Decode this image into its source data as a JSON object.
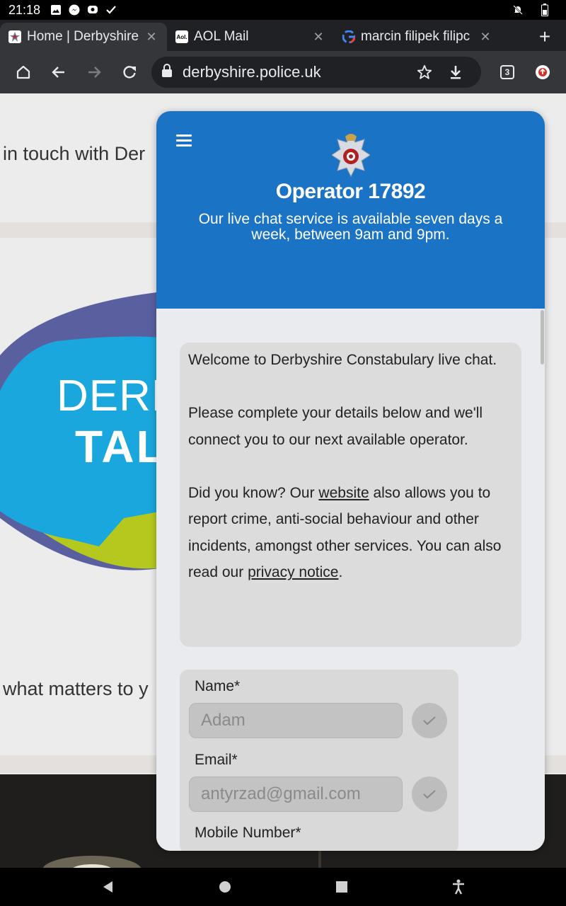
{
  "status_bar": {
    "time": "21:18",
    "left_icons": [
      "image-icon",
      "messenger-icon",
      "chat-bubble-icon",
      "check-icon"
    ],
    "right_icons": [
      "notifications-off-icon",
      "battery-icon"
    ]
  },
  "tabs": [
    {
      "title": "Home | Derbyshire",
      "favicon": "police-crest-favicon",
      "active": true
    },
    {
      "title": "AOL Mail",
      "favicon": "aol-favicon",
      "favicon_text": "Aol.",
      "active": false
    },
    {
      "title": "marcin filipek filipc",
      "favicon": "google-favicon",
      "active": false
    }
  ],
  "toolbar": {
    "url": "derbyshire.police.uk",
    "tab_count": "3"
  },
  "background_page": {
    "line1": "in touch with Der",
    "logo_word1": "DERB",
    "logo_word2": "TAL",
    "line2": "what matters to y"
  },
  "chat": {
    "operator_title": "Operator 17892",
    "subtitle": "Our live chat service is available seven days a week, between 9am and 9pm.",
    "message": {
      "p1": "Welcome to Derbyshire Constabulary live chat.",
      "p2": "Please complete your details below and we'll connect you to our next available operator.",
      "p3_before": "Did you know? Our ",
      "p3_link1": "website",
      "p3_middle": " also allows you to report crime, anti-social behaviour and other incidents, amongst other services. You can also read our ",
      "p3_link2": "privacy notice",
      "p3_after": "."
    },
    "form": {
      "name_label": "Name*",
      "name_value": "Adam",
      "email_label": "Email*",
      "email_value": "antyrzad@gmail.com",
      "mobile_label": "Mobile Number*"
    }
  },
  "colors": {
    "header_blue": "#1b73c6",
    "browser_dark": "#202124",
    "toolbar": "#35363a"
  }
}
